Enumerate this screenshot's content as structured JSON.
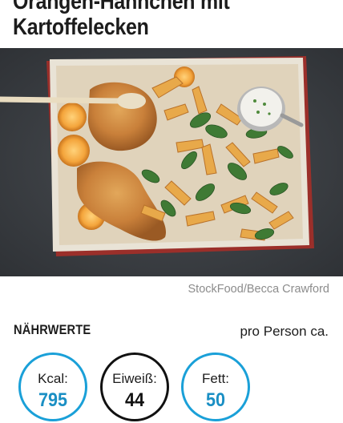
{
  "recipe": {
    "title_line1": "Orangen-Hähnchen mit",
    "title_line2": "Kartoffelecken",
    "photo_credit": "StockFood/Becca Crawford"
  },
  "nutrition": {
    "heading": "NÄHRWERTE",
    "per_serving": "pro Person ca.",
    "items": [
      {
        "label": "Kcal:",
        "value": "795",
        "ring_color": "#1aa0d8"
      },
      {
        "label": "Eiweiß:",
        "value": "44",
        "ring_color": "#111111"
      },
      {
        "label": "Fett:",
        "value": "50",
        "ring_color": "#1aa0d8"
      }
    ]
  },
  "colors": {
    "accent": "#1aa0d8",
    "text": "#1c1c1c",
    "muted": "#8c8c8c"
  }
}
